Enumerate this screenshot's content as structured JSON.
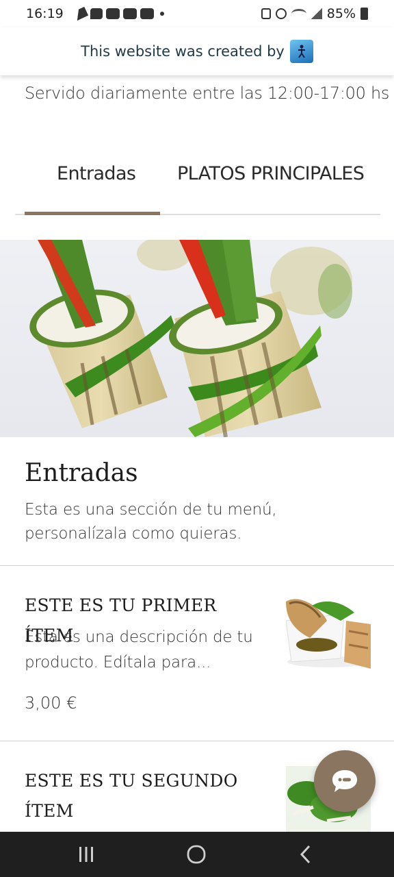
{
  "status_bar": {
    "time": "16:19",
    "battery": "85%"
  },
  "banner": {
    "text": "This website was created by"
  },
  "menu": {
    "served": "Servido diariamente entre las 12:00-17:00 hs",
    "tabs": [
      {
        "label": "Entradas",
        "active": true
      },
      {
        "label": "PLATOS PRINCIPALES",
        "active": false
      }
    ]
  },
  "section": {
    "title": "Entradas",
    "description": "Esta es una sección de tu menú, personalízala como quieras."
  },
  "items": [
    {
      "title": "ESTE ES TU PRIMER ÍTEM",
      "description": "Esta es una descripción de tu producto. Edítala para...",
      "price": "3,00 €"
    },
    {
      "title": "ESTE ES TU SEGUNDO ÍTEM"
    }
  ],
  "colors": {
    "accent": "#8a7660",
    "nav_bg": "#1f1f1f",
    "banner_text": "#1e3a4a"
  },
  "icons": [
    "telegram-icon",
    "chat-icon",
    "youtube-icon",
    "alarm-icon",
    "wifi-icon",
    "signal-icon",
    "battery-icon",
    "wix-logo-icon",
    "chat-bubble-icon",
    "recents-icon",
    "home-icon",
    "back-icon"
  ]
}
